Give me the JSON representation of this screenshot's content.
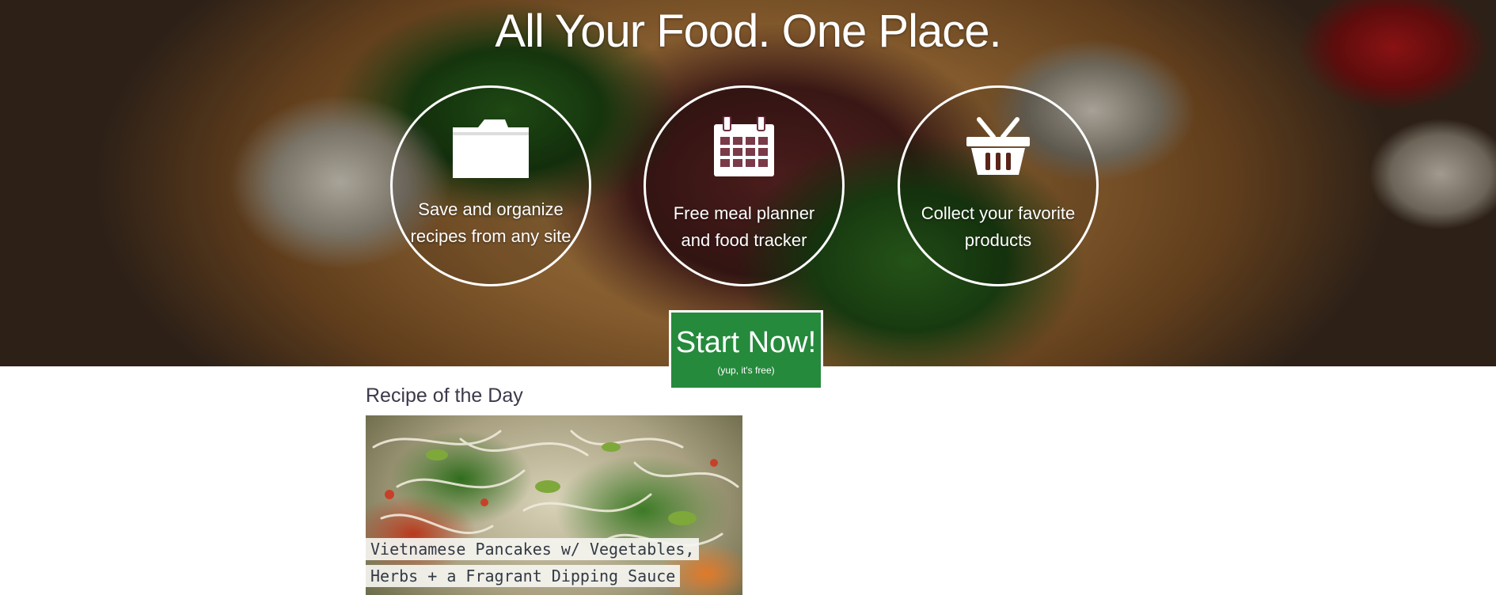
{
  "hero": {
    "title": "All Your Food. One Place.",
    "features": [
      {
        "icon": "folder-icon",
        "label": "Save and organize recipes from any site"
      },
      {
        "icon": "calendar-icon",
        "label": "Free meal planner and food tracker"
      },
      {
        "icon": "basket-icon",
        "label": "Collect your favorite products"
      }
    ]
  },
  "cta": {
    "label": "Start Now!",
    "sublabel": "(yup, it's free)",
    "color": "#258a3c"
  },
  "recipe_of_the_day": {
    "heading": "Recipe of the Day",
    "title": "Vietnamese Pancakes w/ Vegetables, Herbs + a Fragrant Dipping Sauce"
  }
}
